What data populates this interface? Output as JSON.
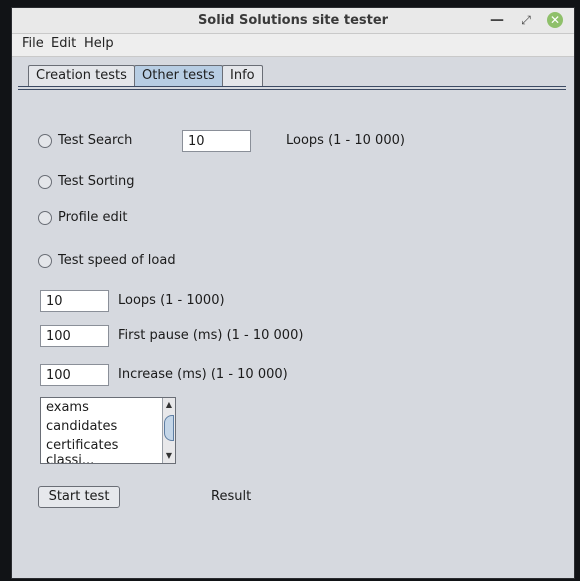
{
  "window": {
    "title": "Solid Solutions site tester"
  },
  "menu": [
    "File",
    "Edit",
    "Help"
  ],
  "tabs": [
    "Creation tests",
    "Other tests",
    "Info"
  ],
  "options": {
    "search": "Test Search",
    "sorting": "Test Sorting",
    "profile": "Profile edit",
    "speed": "Test speed of load"
  },
  "search": {
    "value": "10",
    "hint": "Loops (1 - 10 000)"
  },
  "speed": {
    "loops": {
      "value": "10",
      "label": "Loops (1 - 1000)"
    },
    "pause": {
      "value": "100",
      "label": "First pause (ms) (1 - 10 000)"
    },
    "increase": {
      "value": "100",
      "label": "Increase (ms) (1 - 10 000)"
    }
  },
  "list": [
    "exams",
    "candidates",
    "certificates",
    "classi..."
  ],
  "actions": {
    "start": "Start test",
    "result": "Result"
  }
}
